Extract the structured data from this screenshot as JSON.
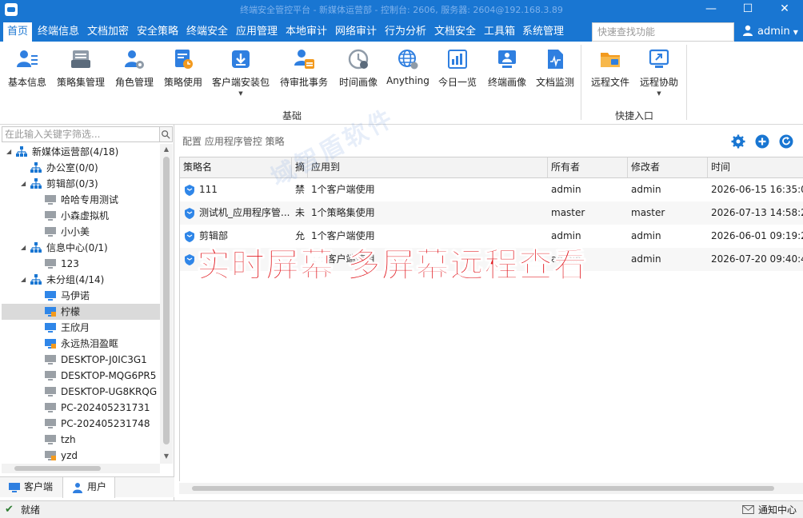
{
  "window": {
    "title": "终端安全管控平台 - 新媒体运营部 - 控制台: 2606, 服务器: 2604@192.168.3.89",
    "min_label": "—",
    "max_label": "☐",
    "close_label": "✕"
  },
  "menu": {
    "items": [
      "首页",
      "终端信息",
      "文档加密",
      "安全策略",
      "终端安全",
      "应用管理",
      "本地审计",
      "网络审计",
      "行为分析",
      "文档安全",
      "工具箱",
      "系统管理"
    ],
    "active_index": 0,
    "search_placeholder": "快速查找功能",
    "user": "admin"
  },
  "ribbon": {
    "buttons": [
      {
        "label": "基本信息",
        "icon": "person-info-icon"
      },
      {
        "label": "策略集管理",
        "icon": "policy-set-icon"
      },
      {
        "label": "角色管理",
        "icon": "role-icon"
      },
      {
        "label": "策略使用",
        "icon": "policy-use-icon"
      },
      {
        "label": "客户端安装包",
        "icon": "installer-icon",
        "has_dropdown": true
      },
      {
        "label": "待审批事务",
        "icon": "approval-icon"
      },
      {
        "label": "时间画像",
        "icon": "time-portrait-icon"
      },
      {
        "label": "Anything",
        "icon": "globe-icon"
      },
      {
        "label": "今日一览",
        "icon": "dashboard-icon"
      },
      {
        "label": "终端画像",
        "icon": "terminal-portrait-icon"
      },
      {
        "label": "文档监测",
        "icon": "doc-monitor-icon"
      },
      {
        "label": "远程文件",
        "icon": "remote-file-icon"
      },
      {
        "label": "远程协助",
        "icon": "remote-assist-icon",
        "has_dropdown": true
      }
    ],
    "groups": [
      "基础",
      "快捷入口"
    ]
  },
  "left": {
    "filter_placeholder": "在此输入关键字筛选...",
    "tree": [
      {
        "label": "新媒体运营部(4/18)",
        "type": "org",
        "level": 0,
        "expanded": true
      },
      {
        "label": "办公室(0/0)",
        "type": "org",
        "level": 1
      },
      {
        "label": "剪辑部(0/3)",
        "type": "org",
        "level": 1,
        "expanded": true
      },
      {
        "label": "哈哈专用测试",
        "type": "pc-off",
        "level": 2
      },
      {
        "label": "小森虚拟机",
        "type": "pc-off",
        "level": 2
      },
      {
        "label": "小小美",
        "type": "pc-off",
        "level": 2
      },
      {
        "label": "信息中心(0/1)",
        "type": "org",
        "level": 1,
        "expanded": true
      },
      {
        "label": "123",
        "type": "pc-off",
        "level": 2
      },
      {
        "label": "未分组(4/14)",
        "type": "org",
        "level": 1,
        "expanded": true
      },
      {
        "label": "马伊诺",
        "type": "pc-on",
        "level": 2
      },
      {
        "label": "柠檬",
        "type": "pc-on-warn",
        "level": 2,
        "selected": true
      },
      {
        "label": "王欣月",
        "type": "pc-on",
        "level": 2
      },
      {
        "label": "永远热泪盈眶",
        "type": "pc-on-warn",
        "level": 2
      },
      {
        "label": "DESKTOP-J0IC3G1",
        "type": "pc-off",
        "level": 2
      },
      {
        "label": "DESKTOP-MQG6PR5",
        "type": "pc-off",
        "level": 2
      },
      {
        "label": "DESKTOP-UG8KRQG",
        "type": "pc-off",
        "level": 2
      },
      {
        "label": "PC-202405231731",
        "type": "pc-off",
        "level": 2
      },
      {
        "label": "PC-202405231748",
        "type": "pc-off",
        "level": 2
      },
      {
        "label": "tzh",
        "type": "pc-off",
        "level": 2
      },
      {
        "label": "yzd",
        "type": "pc-off-warn",
        "level": 2
      }
    ],
    "tabs": [
      "客户端",
      "用户"
    ],
    "active_tab": 1
  },
  "right": {
    "breadcrumb": "配置 应用程序管控 策略",
    "columns": [
      "策略名",
      "摘",
      "应用到",
      "所有者",
      "修改者",
      "时间"
    ],
    "rows": [
      [
        "111",
        "禁",
        "1个客户端使用",
        "admin",
        "admin",
        "2026-06-15 16:35:0"
      ],
      [
        "测试机_应用程序管...",
        "未",
        "1个策略集使用",
        "master",
        "master",
        "2026-07-13 14:58:2"
      ],
      [
        "剪辑部",
        "允",
        "1个客户端使用",
        "admin",
        "admin",
        "2026-06-01 09:19:2"
      ],
      [
        "",
        "",
        "1个客户端使用",
        "admin",
        "admin",
        "2026-07-20 09:40:4"
      ]
    ]
  },
  "watermark": "域智盾软件",
  "overlay": "实时屏幕 多屏幕远程查看",
  "status": {
    "left": "就绪",
    "right": "通知中心"
  },
  "colors": {
    "primary": "#1976d2",
    "overlay_red": "#e0141b",
    "selected_row": "#dadada"
  }
}
